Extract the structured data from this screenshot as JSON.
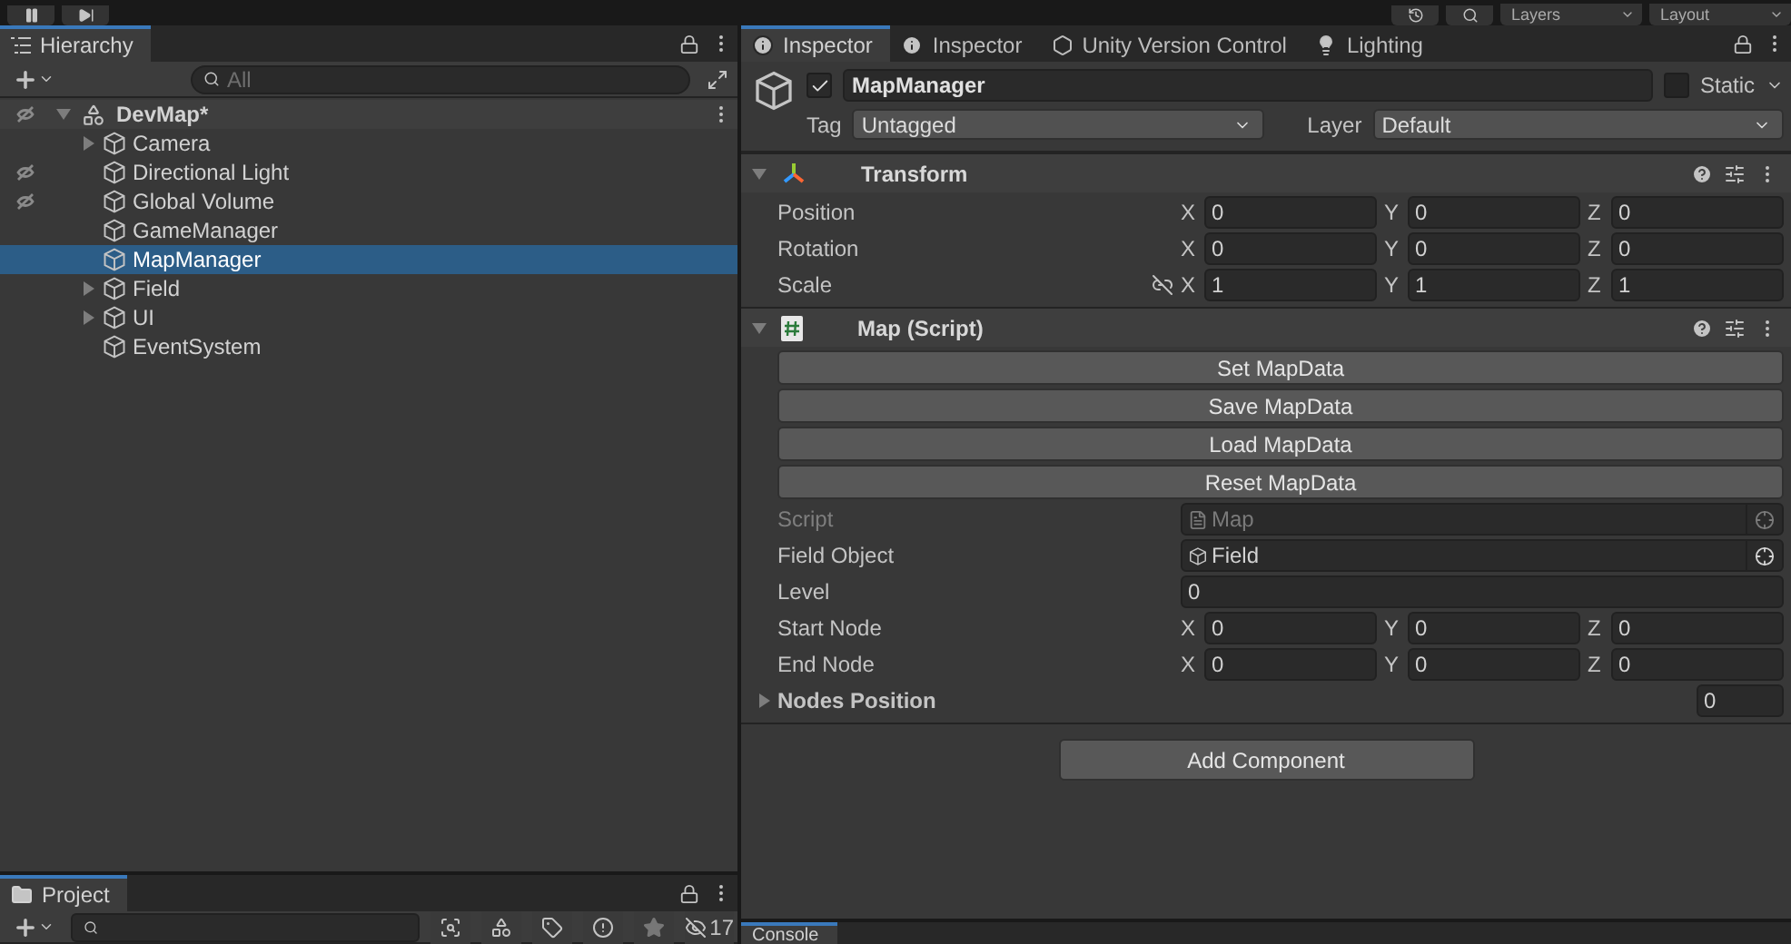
{
  "toolbar": {
    "left_buttons": [
      {
        "kind": "pause"
      },
      {
        "kind": "step"
      }
    ],
    "right_buttons": [
      {
        "kind": "history"
      },
      {
        "kind": "search"
      }
    ],
    "dropdowns": [
      "Layers",
      "Layout"
    ]
  },
  "hierarchy": {
    "tab": "Hierarchy",
    "search": {
      "placeholder": "All"
    },
    "scene": {
      "name": "DevMap*",
      "expanded": true,
      "children": [
        {
          "name": "Camera",
          "expandable": true,
          "hidden": false,
          "selected": false
        },
        {
          "name": "Directional Light",
          "expandable": false,
          "hidden": true,
          "selected": false
        },
        {
          "name": "Global Volume",
          "expandable": false,
          "hidden": true,
          "selected": false
        },
        {
          "name": "GameManager",
          "expandable": false,
          "hidden": false,
          "selected": false
        },
        {
          "name": "MapManager",
          "expandable": false,
          "hidden": false,
          "selected": true
        },
        {
          "name": "Field",
          "expandable": true,
          "hidden": false,
          "selected": false
        },
        {
          "name": "UI",
          "expandable": true,
          "hidden": false,
          "selected": false
        },
        {
          "name": "EventSystem",
          "expandable": false,
          "hidden": false,
          "selected": false
        }
      ]
    }
  },
  "inspector": {
    "tabs": [
      {
        "label": "Inspector",
        "kind": "info",
        "selected": true
      },
      {
        "label": "Inspector",
        "kind": "info",
        "selected": false
      },
      {
        "label": "Unity Version Control",
        "kind": "vcs",
        "selected": false
      },
      {
        "label": "Lighting",
        "kind": "bulb",
        "selected": false
      }
    ],
    "object": {
      "name": "MapManager",
      "active": true,
      "static": false,
      "static_label": "Static",
      "tag_label": "Tag",
      "tag": "Untagged",
      "layer_label": "Layer",
      "layer": "Default"
    },
    "components": [
      {
        "title": "Transform",
        "kind": "transform",
        "expanded": true,
        "rows": [
          {
            "kind": "vector",
            "label": "Position",
            "fields": [
              {
                "axis": "X",
                "value": "0"
              },
              {
                "axis": "Y",
                "value": "0"
              },
              {
                "axis": "Z",
                "value": "0"
              }
            ]
          },
          {
            "kind": "vector",
            "label": "Rotation",
            "fields": [
              {
                "axis": "X",
                "value": "0"
              },
              {
                "axis": "Y",
                "value": "0"
              },
              {
                "axis": "Z",
                "value": "0"
              }
            ]
          },
          {
            "kind": "vector",
            "label": "Scale",
            "linked": false,
            "fields": [
              {
                "axis": "X",
                "value": "1"
              },
              {
                "axis": "Y",
                "value": "1"
              },
              {
                "axis": "Z",
                "value": "1"
              }
            ]
          }
        ]
      },
      {
        "title": "Map (Script)",
        "kind": "script",
        "expanded": true,
        "buttons": [
          "Set MapData",
          "Save MapData",
          "Load MapData",
          "Reset MapData"
        ],
        "rows": [
          {
            "kind": "object",
            "label": "Script",
            "disabled": true,
            "value": "Map"
          },
          {
            "kind": "object",
            "label": "Field Object",
            "disabled": false,
            "value": "Field"
          },
          {
            "kind": "number",
            "label": "Level",
            "value": "0"
          },
          {
            "kind": "vector",
            "label": "Start Node",
            "fields": [
              {
                "axis": "X",
                "value": "0"
              },
              {
                "axis": "Y",
                "value": "0"
              },
              {
                "axis": "Z",
                "value": "0"
              }
            ]
          },
          {
            "kind": "vector",
            "label": "End Node",
            "fields": [
              {
                "axis": "X",
                "value": "0"
              },
              {
                "axis": "Y",
                "value": "0"
              },
              {
                "axis": "Z",
                "value": "0"
              }
            ]
          },
          {
            "kind": "list",
            "label": "Nodes Position",
            "expanded": false,
            "value": "0"
          }
        ]
      }
    ],
    "add_component": "Add Component"
  },
  "project": {
    "tab": "Project",
    "hidden_count": "17"
  },
  "console": {
    "tab": "Console"
  }
}
